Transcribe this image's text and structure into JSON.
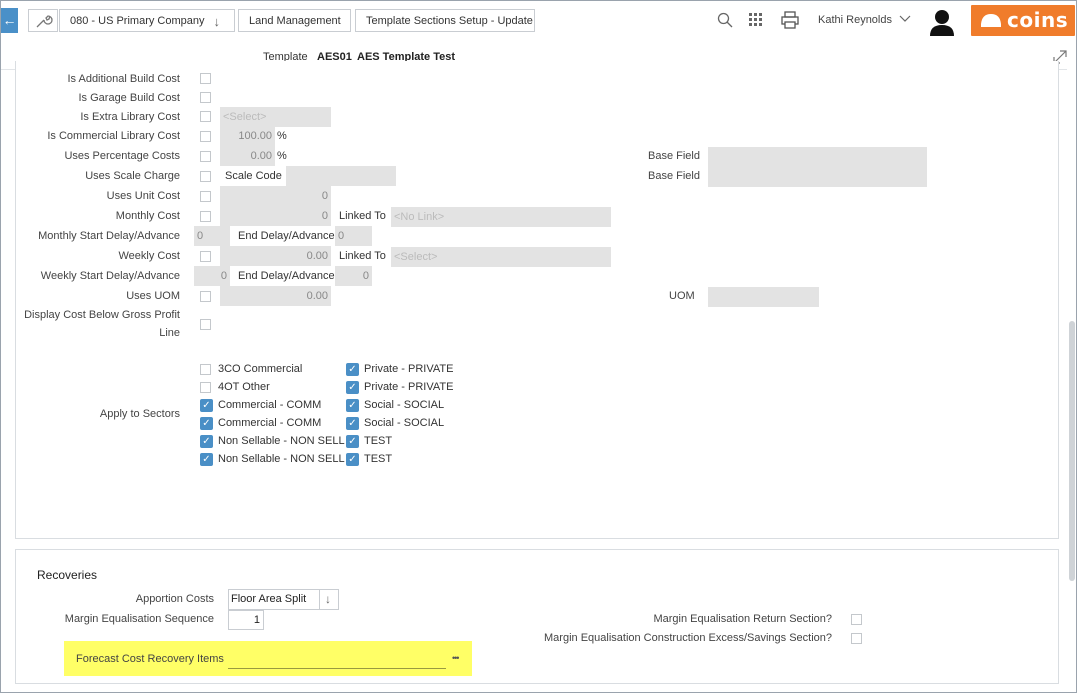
{
  "header": {
    "company": "080 - US Primary Company",
    "module": "Land Management",
    "page": "Template Sections Setup - Update",
    "user": "Kathi Reynolds",
    "brand": "coins",
    "brand_color": "#f07c2b"
  },
  "template": {
    "label": "Template",
    "code": "AES01",
    "name": "AES Template Test"
  },
  "form": {
    "is_additional_build_cost": "Is Additional Build Cost",
    "is_garage_build_cost": "Is Garage Build Cost",
    "is_extra_library_cost": "Is Extra Library Cost",
    "extra_library_select": "<Select>",
    "is_commercial_library_cost": "Is Commercial Library Cost",
    "commercial_pct": "100.00",
    "pct_sign": "%",
    "uses_percentage_costs": "Uses Percentage Costs",
    "percentage_value": "0.00",
    "base_field_label": "Base Field",
    "uses_scale_charge": "Uses Scale Charge",
    "scale_code_label": "Scale Code",
    "uses_unit_cost": "Uses Unit Cost",
    "unit_cost_value": "0",
    "monthly_cost": "Monthly Cost",
    "monthly_cost_value": "0",
    "linked_to_label": "Linked To",
    "monthly_link": "<No Link>",
    "monthly_start_delay": "Monthly Start Delay/Advance",
    "monthly_start_value": "0",
    "end_delay_label": "End Delay/Advance",
    "monthly_end_value": "0",
    "weekly_cost": "Weekly Cost",
    "weekly_cost_value": "0.00",
    "weekly_link": "<Select>",
    "weekly_start_delay": "Weekly Start Delay/Advance",
    "weekly_start_value": "0",
    "weekly_end_value": "0",
    "uses_uom": "Uses UOM",
    "uom_value": "0.00",
    "uom_label": "UOM",
    "display_cost_line1": "Display Cost Below Gross Profit",
    "display_cost_line2": "Line",
    "apply_to_sectors": "Apply to Sectors"
  },
  "sectors": {
    "col1": [
      {
        "label": "3CO Commercial",
        "checked": false
      },
      {
        "label": "4OT Other",
        "checked": false
      },
      {
        "label": "Commercial - COMM",
        "checked": true
      },
      {
        "label": "Commercial - COMM",
        "checked": true
      },
      {
        "label": "Non Sellable - NON SELL",
        "checked": true
      },
      {
        "label": "Non Sellable - NON SELL",
        "checked": true
      }
    ],
    "col2": [
      {
        "label": "Private - PRIVATE",
        "checked": true
      },
      {
        "label": "Private - PRIVATE",
        "checked": true
      },
      {
        "label": "Social - SOCIAL",
        "checked": true
      },
      {
        "label": "Social - SOCIAL",
        "checked": true
      },
      {
        "label": "TEST",
        "checked": true
      },
      {
        "label": "TEST",
        "checked": true
      }
    ]
  },
  "recoveries": {
    "title": "Recoveries",
    "apportion_costs_label": "Apportion Costs",
    "apportion_costs_value": "Floor Area Split",
    "margin_seq_label": "Margin Equalisation Sequence",
    "margin_seq_value": "1",
    "margin_return_label": "Margin Equalisation Return Section?",
    "margin_construction_label": "Margin Equalisation Construction Excess/Savings Section?",
    "forecast_label": "Forecast Cost Recovery Items",
    "forecast_value": "",
    "more_glyph": "•••",
    "highlight_color": "#ffff66"
  }
}
